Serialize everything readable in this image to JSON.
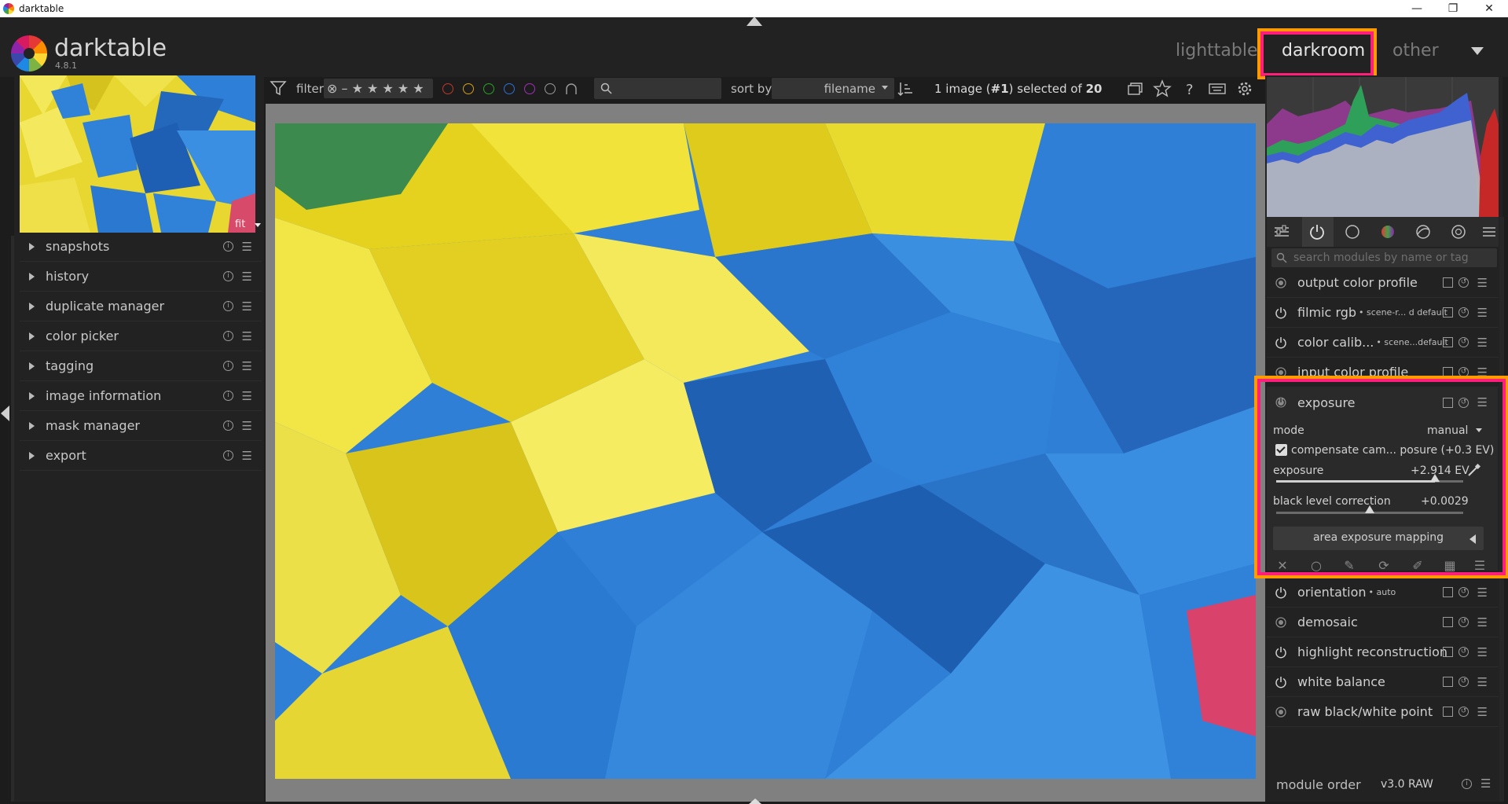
{
  "window": {
    "title": "darktable",
    "controls": [
      "—",
      "❐",
      "✕"
    ]
  },
  "app": {
    "name": "darktable",
    "version": "4.8.1"
  },
  "views": {
    "items": [
      "lighttable",
      "darkroom",
      "other"
    ],
    "active": "darkroom"
  },
  "navigation": {
    "zoom": "fit"
  },
  "left_modules": [
    {
      "label": "snapshots"
    },
    {
      "label": "history"
    },
    {
      "label": "duplicate manager"
    },
    {
      "label": "color picker"
    },
    {
      "label": "tagging"
    },
    {
      "label": "image information"
    },
    {
      "label": "mask manager"
    },
    {
      "label": "export"
    }
  ],
  "filterbar": {
    "filter_label": "filter",
    "stars": "⊗ – ★ ★ ★ ★ ★",
    "color_labels": [
      "#c0392b",
      "#d4a017",
      "#27a327",
      "#2f6fd6",
      "#a32fb8",
      "#9a9a9a"
    ],
    "search_placeholder": "",
    "sort_label": "sort by",
    "sort_value": "filename",
    "selection_text_1": "1 image (",
    "selection_text_bold_1": "#1",
    "selection_text_2": ") selected of ",
    "selection_text_bold_2": "20"
  },
  "right_panel": {
    "module_search_placeholder": "search modules by name or tag",
    "modules_top": [
      {
        "name": "output color profile",
        "sub": "",
        "state": "fixed"
      },
      {
        "name": "filmic rgb",
        "sub": "• scene-r... d default",
        "state": "on"
      },
      {
        "name": "color calib...",
        "sub": "• scene...default",
        "state": "on"
      },
      {
        "name": "input color profile",
        "sub": "",
        "state": "fixed"
      }
    ],
    "exposure": {
      "name": "exposure",
      "mode_label": "mode",
      "mode_value": "manual",
      "compensate_label": "compensate cam... posure (+0.3 EV)",
      "compensate_checked": true,
      "exposure_label": "exposure",
      "exposure_value": "+2.914 EV",
      "exposure_fraction": 0.85,
      "black_label": "black level correction",
      "black_value": "+0.0029",
      "black_fraction": 0.5,
      "area_button": "area exposure mapping"
    },
    "modules_bottom": [
      {
        "name": "orientation",
        "sub": "• auto",
        "state": "on"
      },
      {
        "name": "demosaic",
        "sub": "",
        "state": "fixed"
      },
      {
        "name": "highlight reconstruction",
        "sub": "",
        "state": "on"
      },
      {
        "name": "white balance",
        "sub": "",
        "state": "on"
      },
      {
        "name": "raw black/white point",
        "sub": "",
        "state": "fixed"
      }
    ],
    "footer_label": "module order",
    "footer_value": "v3.0 RAW"
  },
  "colors": {
    "highlight_orange": "#ff9a00",
    "highlight_pink": "#ff1f7a",
    "panel_bg": "#222222"
  }
}
